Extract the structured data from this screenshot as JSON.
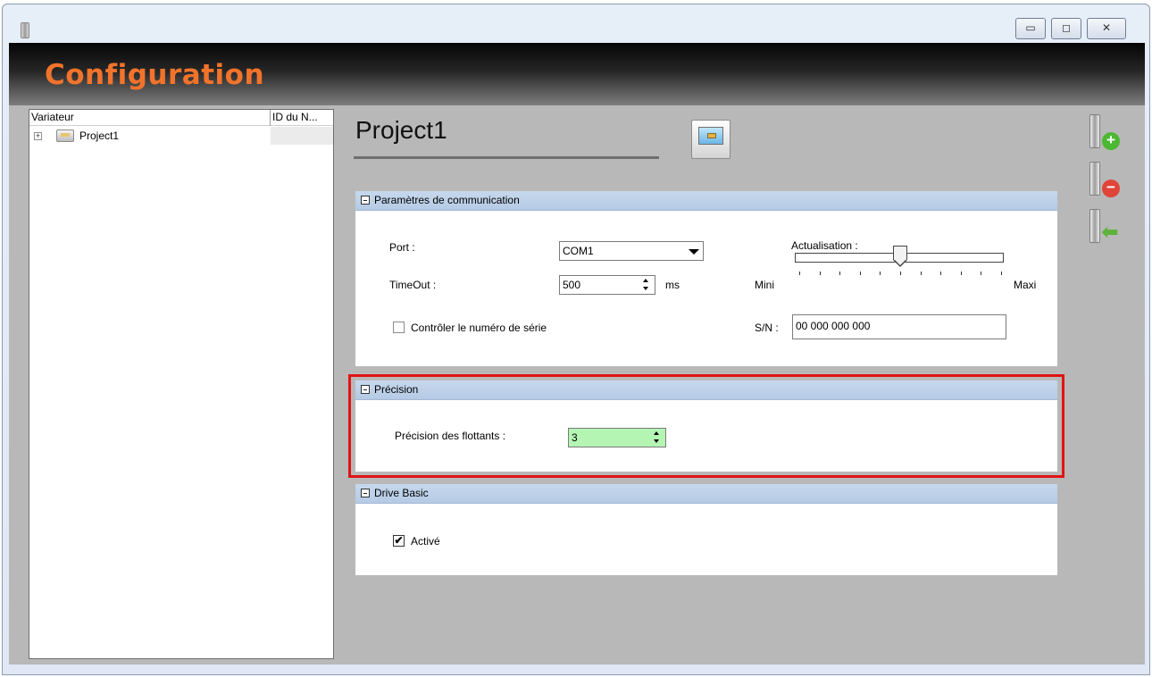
{
  "window": {
    "buttons": {
      "minimize": "▭",
      "maximize": "◻",
      "close": "✕"
    }
  },
  "header": {
    "title": "Configuration"
  },
  "tree": {
    "columns": [
      "Variateur",
      "ID du N..."
    ],
    "rows": [
      {
        "label": "Project1",
        "expander": "+"
      }
    ]
  },
  "main": {
    "title": "Project1",
    "side_icons": [
      "add-drive-icon",
      "remove-drive-icon",
      "import-drive-icon"
    ],
    "sections": {
      "communication": {
        "header": "Paramètres de communication",
        "port_label": "Port :",
        "port_value": "COM1",
        "timeout_label": "TimeOut :",
        "timeout_value": "500",
        "timeout_unit": "ms",
        "refresh_label": "Actualisation :",
        "slider_min": "Mini",
        "slider_max": "Maxi",
        "slider_value_fraction": 0.5,
        "check_serial_label": "Contrôler le numéro de série",
        "check_serial_checked": false,
        "sn_label": "S/N :",
        "sn_value": "00 000 000 000"
      },
      "precision": {
        "header": "Précision",
        "float_label": "Précision des flottants :",
        "float_value": "3"
      },
      "drive_basic": {
        "header": "Drive Basic",
        "active_label": "Activé",
        "active_checked": true
      }
    }
  },
  "colors": {
    "title_accent": "#f2732b",
    "section_header": "#bdd0e8",
    "highlight_border": "#e01414",
    "precision_field_bg": "#b4f5b4"
  }
}
